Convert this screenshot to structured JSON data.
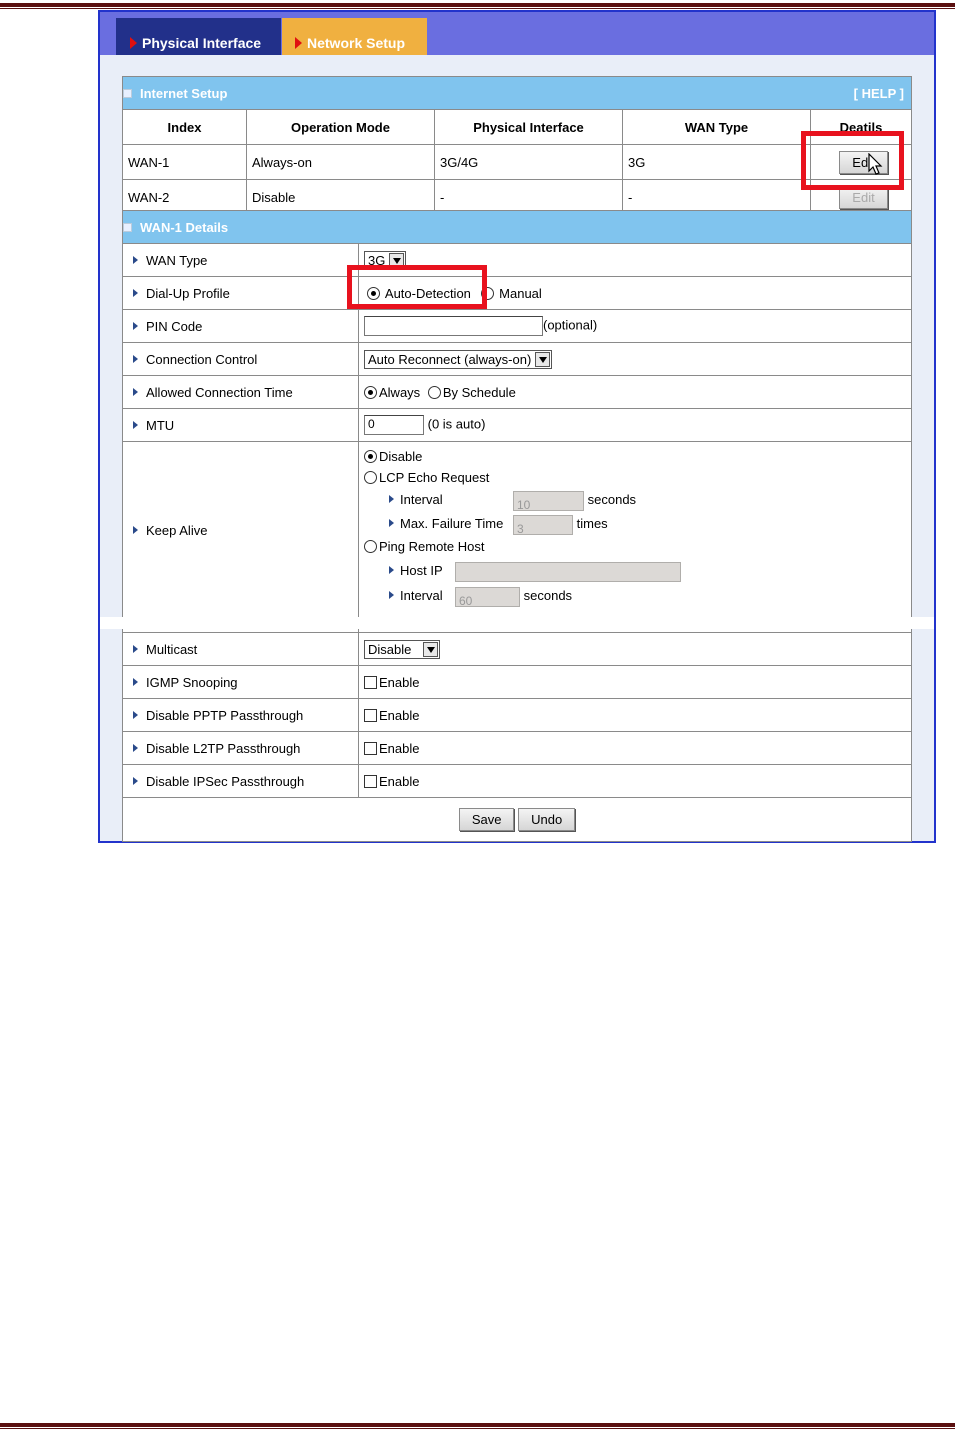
{
  "tabs": [
    {
      "label": "Physical Interface"
    },
    {
      "label": "Network Setup"
    }
  ],
  "internet_setup": {
    "title": "Internet Setup",
    "help": "[ HELP ]",
    "columns": [
      "Index",
      "Operation Mode",
      "Physical Interface",
      "WAN Type",
      "Deatils"
    ],
    "rows": [
      {
        "index": "WAN-1",
        "mode": "Always-on",
        "physical": "3G/4G",
        "wan_type": "3G",
        "action": "Edit"
      },
      {
        "index": "WAN-2",
        "mode": "Disable",
        "physical": "-",
        "wan_type": "-",
        "action": "Edit"
      }
    ]
  },
  "wan_details": {
    "title": "WAN-1 Details",
    "wan_type": {
      "label": "WAN Type",
      "value": "3G"
    },
    "dialup": {
      "label": "Dial-Up Profile",
      "opt1": "Auto-Detection",
      "opt2": "Manual"
    },
    "pin": {
      "label": "PIN Code",
      "value": "",
      "hint": "(optional)"
    },
    "connection_control": {
      "label": "Connection Control",
      "value": "Auto Reconnect (always-on)"
    },
    "allowed_time": {
      "label": "Allowed Connection Time",
      "opt1": "Always",
      "opt2": "By Schedule"
    },
    "mtu": {
      "label": "MTU",
      "value": "0",
      "hint": "(0 is auto)"
    },
    "keep_alive": {
      "label": "Keep Alive",
      "opt_disable": "Disable",
      "opt_lcp": "LCP Echo Request",
      "lcp_interval_label": "Interval",
      "lcp_interval_value": "10",
      "lcp_interval_unit": "seconds",
      "lcp_fail_label": "Max. Failure Time",
      "lcp_fail_value": "3",
      "lcp_fail_unit": "times",
      "opt_ping": "Ping Remote Host",
      "host_ip_label": "Host IP",
      "host_ip_value": "",
      "ping_interval_label": "Interval",
      "ping_interval_value": "60",
      "ping_interval_unit": "seconds"
    },
    "multicast": {
      "label": "Multicast",
      "value": "Disable"
    },
    "igmp": {
      "label": "IGMP Snooping",
      "check": "Enable"
    },
    "pptp": {
      "label": "Disable PPTP Passthrough",
      "check": "Enable"
    },
    "l2tp": {
      "label": "Disable L2TP Passthrough",
      "check": "Enable"
    },
    "ipsec": {
      "label": "Disable IPSec Passthrough",
      "check": "Enable"
    }
  },
  "buttons": {
    "save": "Save",
    "undo": "Undo"
  },
  "colors": {
    "highlight": "#e8121e",
    "section_header": "#80c4ee",
    "tabbar": "#6a6ee0"
  }
}
